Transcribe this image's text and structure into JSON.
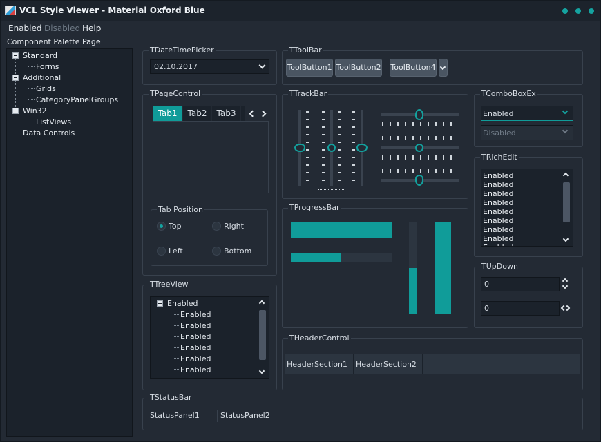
{
  "window": {
    "title": "VCL Style Viewer - Material Oxford Blue",
    "accent_color": "#109c99",
    "title_buttons": [
      "dot-icon",
      "dot-icon",
      "dot-icon"
    ]
  },
  "menu": {
    "items": [
      {
        "label": "Enabled",
        "enabled": true
      },
      {
        "label": "Disabled",
        "enabled": false
      },
      {
        "label": "Help",
        "enabled": true
      }
    ]
  },
  "palette": {
    "label": "Component Palette Page",
    "tree": [
      {
        "label": "Standard",
        "children": [
          "Forms"
        ]
      },
      {
        "label": "Additional",
        "children": [
          "Grids",
          "CategoryPanelGroups"
        ]
      },
      {
        "label": "Win32",
        "children": [
          "ListViews"
        ]
      },
      {
        "label": "Data Controls",
        "children": []
      }
    ]
  },
  "datetimepicker": {
    "title": "TDateTimePicker",
    "value": "02.10.2017"
  },
  "toolbar": {
    "title": "TToolBar",
    "buttons": [
      "ToolButton1",
      "ToolButton2",
      "ToolButton4"
    ]
  },
  "pagecontrol": {
    "title": "TPageControl",
    "tabs": [
      "Tab1",
      "Tab2",
      "Tab3"
    ],
    "active_tab": "Tab1",
    "tab_position": {
      "title": "Tab Position",
      "options": [
        "Top",
        "Right",
        "Left",
        "Bottom"
      ],
      "selected": "Top"
    }
  },
  "trackbar": {
    "title": "TTrackBar"
  },
  "comboboxex": {
    "title": "TComboBoxEx",
    "enabled_value": "Enabled",
    "disabled_value": "Disabled"
  },
  "richedit": {
    "title": "TRichEdit",
    "lines": [
      "Enabled",
      "Enabled",
      "Enabled",
      "Enabled",
      "Enabled",
      "Enabled",
      "Enabled",
      "Enabled",
      "Enabled"
    ]
  },
  "progressbar": {
    "title": "TProgressBar",
    "h1": 1.0,
    "h2": 0.5,
    "v1": 0.5,
    "v2": 1.0
  },
  "updown": {
    "title": "TUpDown",
    "value1": "0",
    "value2": "0"
  },
  "treeview": {
    "title": "TTreeView",
    "root": "Enabled",
    "children": [
      "Enabled",
      "Enabled",
      "Enabled",
      "Enabled",
      "Enabled",
      "Enabled",
      "Enabled"
    ]
  },
  "headercontrol": {
    "title": "THeaderControl",
    "sections": [
      "HeaderSection1",
      "HeaderSection2"
    ]
  },
  "statusbar": {
    "title": "TStatusBar",
    "panels": [
      "StatusPanel1",
      "StatusPanel2"
    ]
  }
}
